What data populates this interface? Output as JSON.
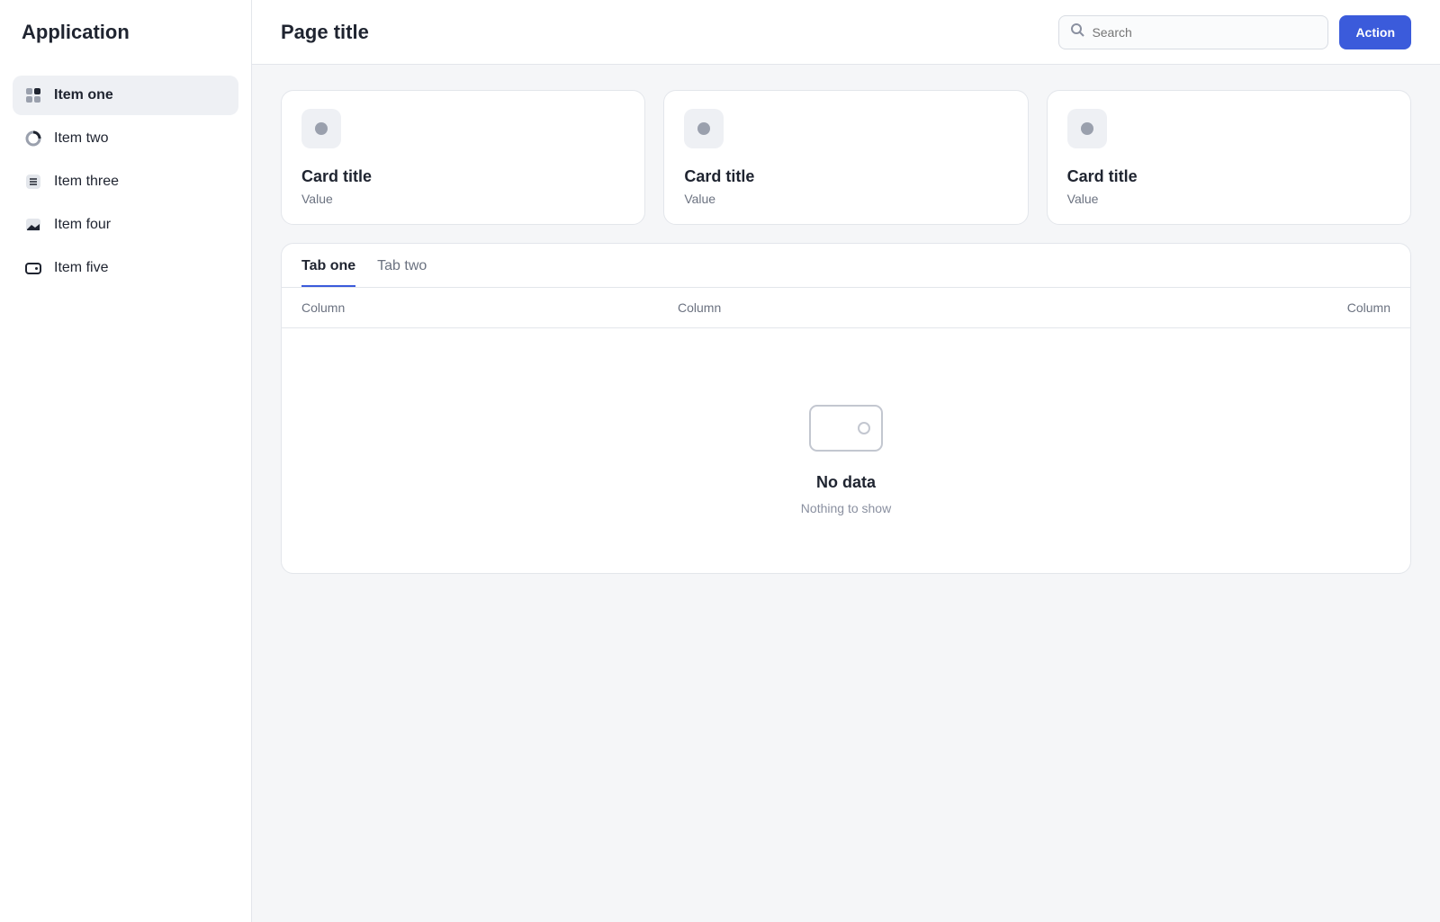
{
  "app": {
    "title": "Application"
  },
  "sidebar": {
    "items": [
      {
        "label": "Item one",
        "icon": "grid-icon"
      },
      {
        "label": "Item two",
        "icon": "chart-icon"
      },
      {
        "label": "Item three",
        "icon": "list-icon"
      },
      {
        "label": "Item four",
        "icon": "image-icon"
      },
      {
        "label": "Item five",
        "icon": "wallet-icon"
      }
    ]
  },
  "header": {
    "title": "Page title",
    "search_placeholder": "Search",
    "action_label": "Action"
  },
  "cards": [
    {
      "title": "Card title",
      "value": "Value"
    },
    {
      "title": "Card title",
      "value": "Value"
    },
    {
      "title": "Card title",
      "value": "Value"
    }
  ],
  "table": {
    "tabs": [
      "Tab one",
      "Tab two"
    ],
    "columns": [
      "Column",
      "Column",
      "Column"
    ],
    "empty_title": "No data",
    "empty_text": "Nothing to show"
  },
  "theme": {
    "accent": "#3b5bdb"
  }
}
